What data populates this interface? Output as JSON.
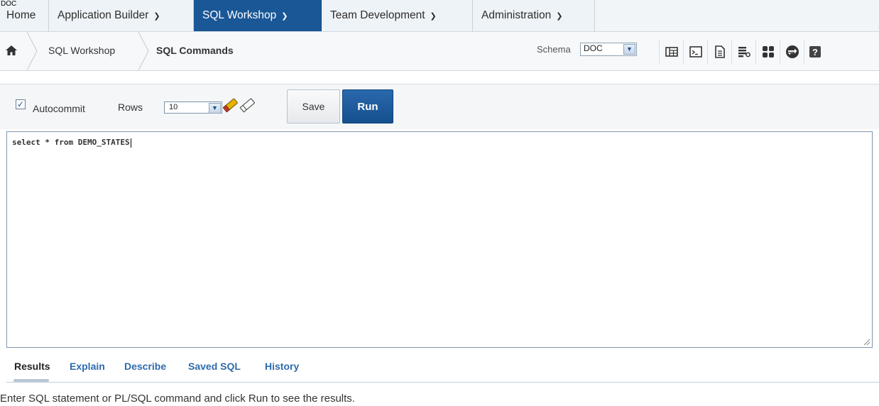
{
  "app": {
    "schema_tag": "DOC"
  },
  "topnav": {
    "tabs": [
      {
        "label": "Home",
        "has_menu": false,
        "active": false
      },
      {
        "label": "Application Builder",
        "has_menu": true,
        "active": false
      },
      {
        "label": "SQL Workshop",
        "has_menu": true,
        "active": true
      },
      {
        "label": "Team Development",
        "has_menu": true,
        "active": false
      },
      {
        "label": "Administration",
        "has_menu": true,
        "active": false
      }
    ]
  },
  "breadcrumb": {
    "items": [
      "SQL Workshop",
      "SQL Commands"
    ],
    "home_icon": "home-icon"
  },
  "schema": {
    "label": "Schema",
    "selected": "DOC"
  },
  "toolbar_icons": [
    "object-browser-icon",
    "sql-commands-icon",
    "sql-scripts-icon",
    "query-builder-icon",
    "utilities-icon",
    "restful-services-icon",
    "help-icon"
  ],
  "editor_toolbar": {
    "autocommit_label": "Autocommit",
    "autocommit_checked": true,
    "rows_label": "Rows",
    "rows_value": "10",
    "find_icon": "find-tables-icon",
    "save_label": "Save",
    "run_label": "Run"
  },
  "editor": {
    "sql": "select * from DEMO_STATES"
  },
  "results": {
    "tabs": [
      "Results",
      "Explain",
      "Describe",
      "Saved SQL",
      "History"
    ],
    "active_tab": "Results",
    "message": "Enter SQL statement or PL/SQL command and click Run to see the results."
  },
  "colors": {
    "nav_active": "#1a5796",
    "run_button": "#1c5a9b",
    "link": "#2e6bad"
  }
}
